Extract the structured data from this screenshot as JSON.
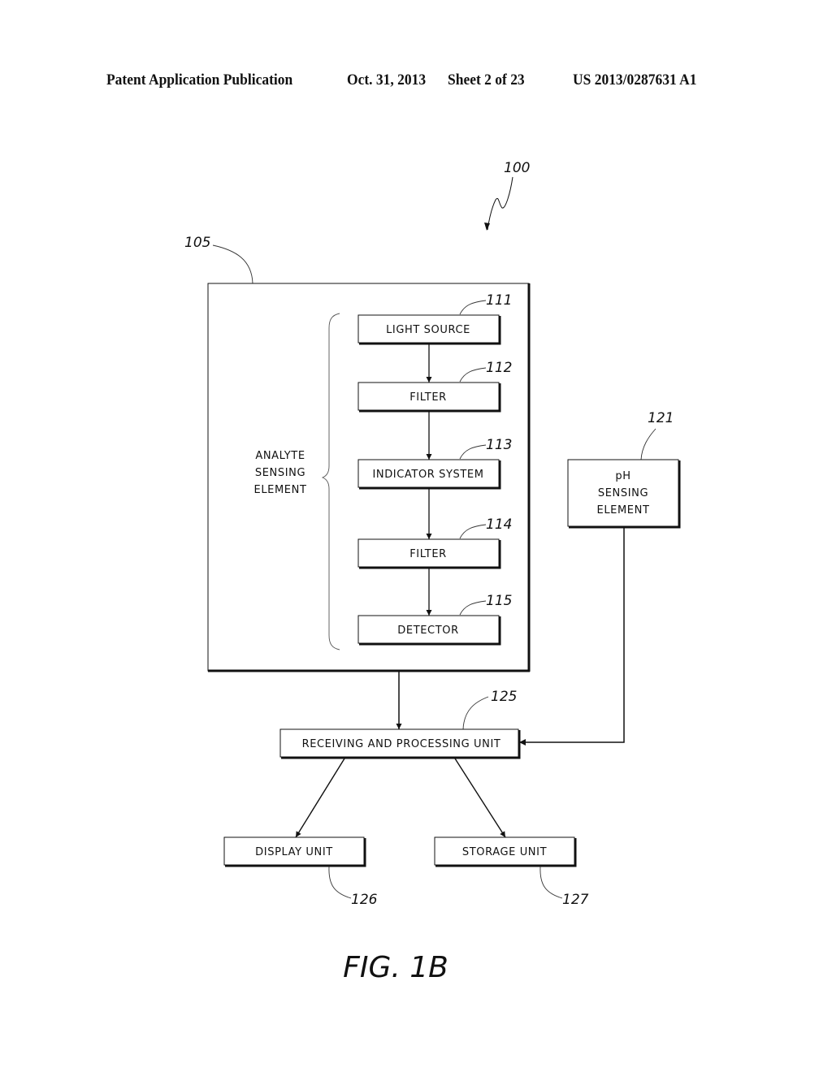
{
  "header": {
    "publication": "Patent Application Publication",
    "date": "Oct. 31, 2013",
    "sheet": "Sheet 2 of 23",
    "number": "US 2013/0287631 A1"
  },
  "diagram": {
    "system_ref": "100",
    "housing_ref": "105",
    "group_label": [
      "ANALYTE",
      "SENSING",
      "ELEMENT"
    ],
    "blocks": {
      "light_source": {
        "label": "LIGHT SOURCE",
        "ref": "111"
      },
      "filter_1": {
        "label": "FILTER",
        "ref": "112"
      },
      "indicator": {
        "label": "INDICATOR SYSTEM",
        "ref": "113"
      },
      "filter_2": {
        "label": "FILTER",
        "ref": "114"
      },
      "detector": {
        "label": "DETECTOR",
        "ref": "115"
      },
      "ph": {
        "label": [
          "pH",
          "SENSING",
          "ELEMENT"
        ],
        "ref": "121"
      },
      "processing": {
        "label": "RECEIVING AND PROCESSING UNIT",
        "ref": "125"
      },
      "display": {
        "label": "DISPLAY UNIT",
        "ref": "126"
      },
      "storage": {
        "label": "STORAGE UNIT",
        "ref": "127"
      }
    },
    "figure_label": "FIG. 1B"
  }
}
